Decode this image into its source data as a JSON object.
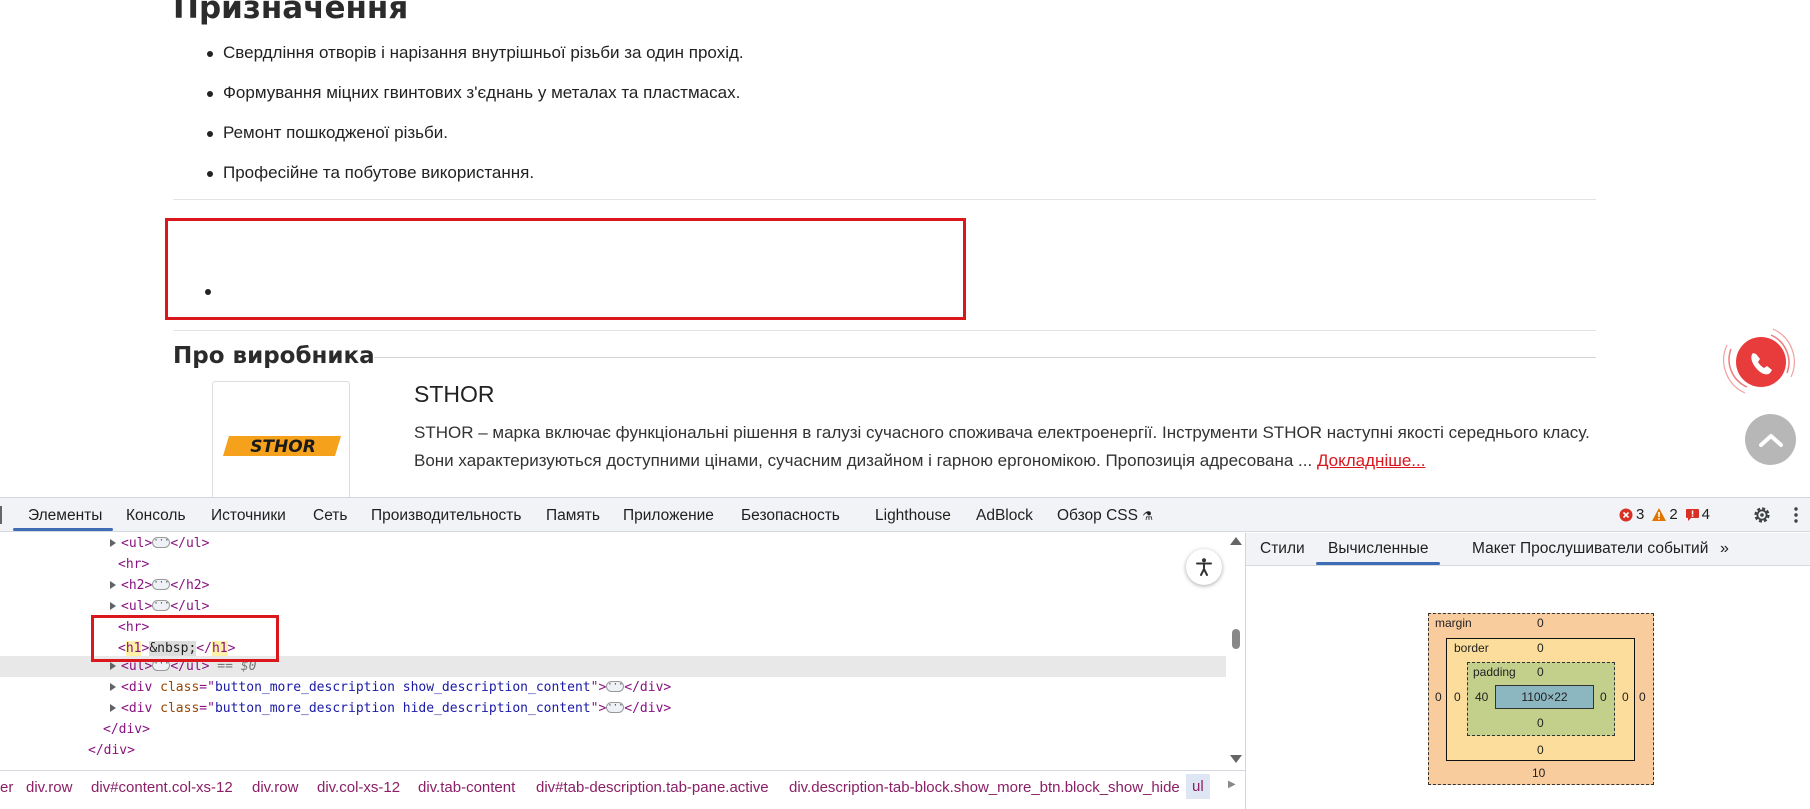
{
  "page": {
    "purpose_heading": "Призначення",
    "purpose_items": [
      "Свердління отворів і нарізання внутрішньої різьби за один прохід.",
      "Формування міцних гвинтових з'єднань у металах та пластмасах.",
      "Ремонт пошкодженої різьби.",
      "Професійне та побутове використання."
    ],
    "maker_heading": "Про виробника",
    "brand_logo_text": "STHOR",
    "brand_name": "STHOR",
    "brand_description": "STHOR – марка включає функціональні рішення в галузі сучасного споживача електроенергії. Інструменти STHOR наступні якості середнього класу. Вони характеризуються доступними цінами, сучасним дизайном і гарною ергономікою. Пропозиція адресована ...",
    "more_link": "Докладніше...",
    "colors": {
      "accent_red": "#d9171d",
      "logo_orange": "#f5a11c"
    }
  },
  "devtools": {
    "tabs": [
      "Элементы",
      "Консоль",
      "Источники",
      "Сеть",
      "Производительность",
      "Память",
      "Приложение",
      "Безопасность",
      "Lighthouse",
      "AdBlock",
      "Обзор CSS"
    ],
    "errors": "3",
    "warnings": "2",
    "issues": "4",
    "dom_lines": {
      "ul1_open": "<ul>",
      "ul1_close": "</ul>",
      "hr1": "<hr>",
      "h2_open": "<h2>",
      "h2_close": "</h2>",
      "ul2_open": "<ul>",
      "ul2_close": "</ul>",
      "hr2": "<hr>",
      "h1_open_lt": "<",
      "h1_tag": "h1",
      "h1_open_gt": ">",
      "h1_text": "&nbsp;",
      "h1_close_lt": "</",
      "h1_close_gt": ">",
      "ul3_open": "<ul>",
      "ul3_close": "</ul>",
      "ul3_eq": "== $0",
      "div1_open": "<div ",
      "div1_attr": "class",
      "div1_eq": "=\"",
      "div1_val": "button_more_description show_description_content",
      "div1_end": "\">",
      "div1_close": "</div>",
      "div2_open": "<div ",
      "div2_attr": "class",
      "div2_eq": "=\"",
      "div2_val": "button_more_description hide_description_content",
      "div2_end": "\">",
      "div2_close": "</div>",
      "div_close_a": "</div>",
      "div_close_b": "</div>"
    },
    "breadcrumbs": [
      "er",
      "div.row",
      "div#content.col-xs-12",
      "div.row",
      "div.col-xs-12",
      "div.tab-content",
      "div#tab-description.tab-pane.active",
      "div.description-tab-block.show_more_btn.block_show_hide",
      "ul"
    ],
    "right_tabs": [
      "Стили",
      "Вычисленные",
      "Макет",
      "Прослушиватели событий"
    ],
    "box_model": {
      "margin_label": "margin",
      "border_label": "border",
      "padding_label": "padding",
      "margin_top": "0",
      "margin_right": "0",
      "margin_bottom": "10",
      "margin_left": "0",
      "border_top": "0",
      "border_right": "0",
      "border_bottom": "0",
      "border_left": "0",
      "padding_top": "0",
      "padding_right": "0",
      "padding_bottom": "0",
      "padding_left": "40",
      "content_size": "1100×22"
    }
  }
}
